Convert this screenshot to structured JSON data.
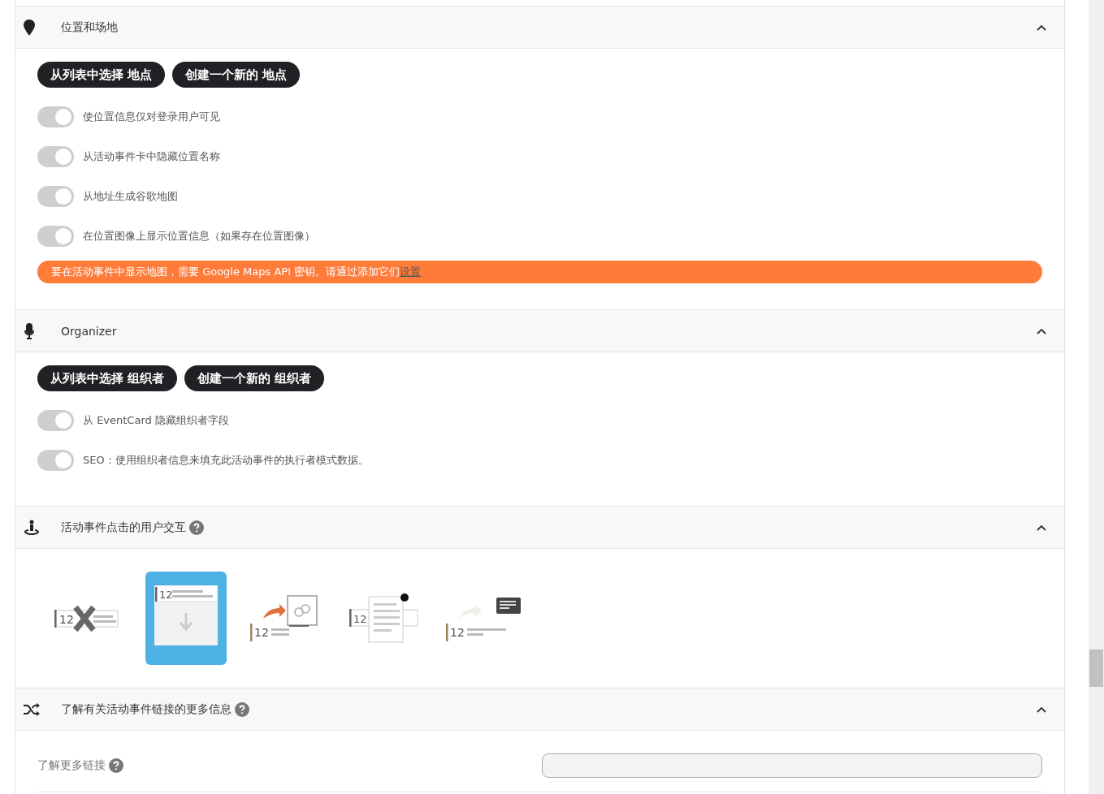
{
  "sections": [
    {
      "kind": "location",
      "title": "位置和场地",
      "expanded": true,
      "buttons": [
        "从列表中选择 地点",
        "创建一个新的 地点"
      ],
      "toggles": [
        {
          "label": "使位置信息仅对登录用户可见",
          "checked": true
        },
        {
          "label": "从活动事件卡中隐藏位置名称",
          "checked": true
        },
        {
          "label": "从地址生成谷歌地图",
          "checked": true
        },
        {
          "label": "在位置图像上显示位置信息（如果存在位置图像）",
          "checked": true
        }
      ],
      "notice": {
        "text": "要在活动事件中显示地图，需要 Google Maps API 密钥。请通过添加它们",
        "link": "设置"
      }
    },
    {
      "kind": "organizer",
      "title": "Organizer",
      "expanded": true,
      "buttons": [
        "从列表中选择 组织者",
        "创建一个新的 组织者"
      ],
      "toggles": [
        {
          "label": "从 EventCard 隐藏组织者字段",
          "checked": true
        },
        {
          "label": "SEO：使用组织者信息来填充此活动事件的执行者模式数据。",
          "checked": true
        }
      ]
    },
    {
      "kind": "interaction",
      "title": "活动事件点击的用户交互",
      "expanded": true,
      "help": true,
      "options": [
        {
          "kind": "none",
          "number": "12",
          "selected": false
        },
        {
          "kind": "slidedown",
          "number": "12",
          "selected": true
        },
        {
          "kind": "link",
          "number": "12",
          "selected": false
        },
        {
          "kind": "popup",
          "number": "12",
          "selected": false
        },
        {
          "kind": "single",
          "number": "12",
          "selected": false
        }
      ]
    },
    {
      "kind": "links",
      "title": "了解有关活动事件链接的更多信息",
      "expanded": true,
      "help": true,
      "field": {
        "label": "了解更多链接",
        "help": true
      }
    }
  ]
}
